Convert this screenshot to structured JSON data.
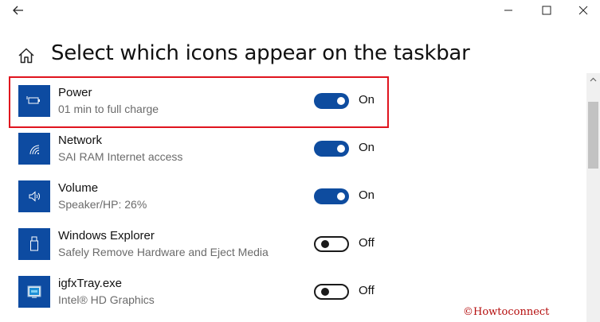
{
  "page": {
    "title": "Select which icons appear on the taskbar"
  },
  "items": [
    {
      "name": "Power",
      "description": "01 min to full charge",
      "state": "On",
      "enabled": true,
      "icon": "battery-charging-icon"
    },
    {
      "name": "Network",
      "description": "SAI RAM Internet access",
      "state": "On",
      "enabled": true,
      "icon": "wifi-icon"
    },
    {
      "name": "Volume",
      "description": "Speaker/HP: 26%",
      "state": "On",
      "enabled": true,
      "icon": "speaker-icon"
    },
    {
      "name": "Windows Explorer",
      "description": "Safely Remove Hardware and Eject Media",
      "state": "Off",
      "enabled": false,
      "icon": "usb-drive-icon"
    },
    {
      "name": "igfxTray.exe",
      "description": "Intel® HD Graphics",
      "state": "Off",
      "enabled": false,
      "icon": "intel-graphics-icon"
    }
  ],
  "watermark": "©Howtoconnect",
  "colors": {
    "accent": "#0d4ba1",
    "highlight": "#e0141e",
    "watermark": "#b50d0d"
  }
}
